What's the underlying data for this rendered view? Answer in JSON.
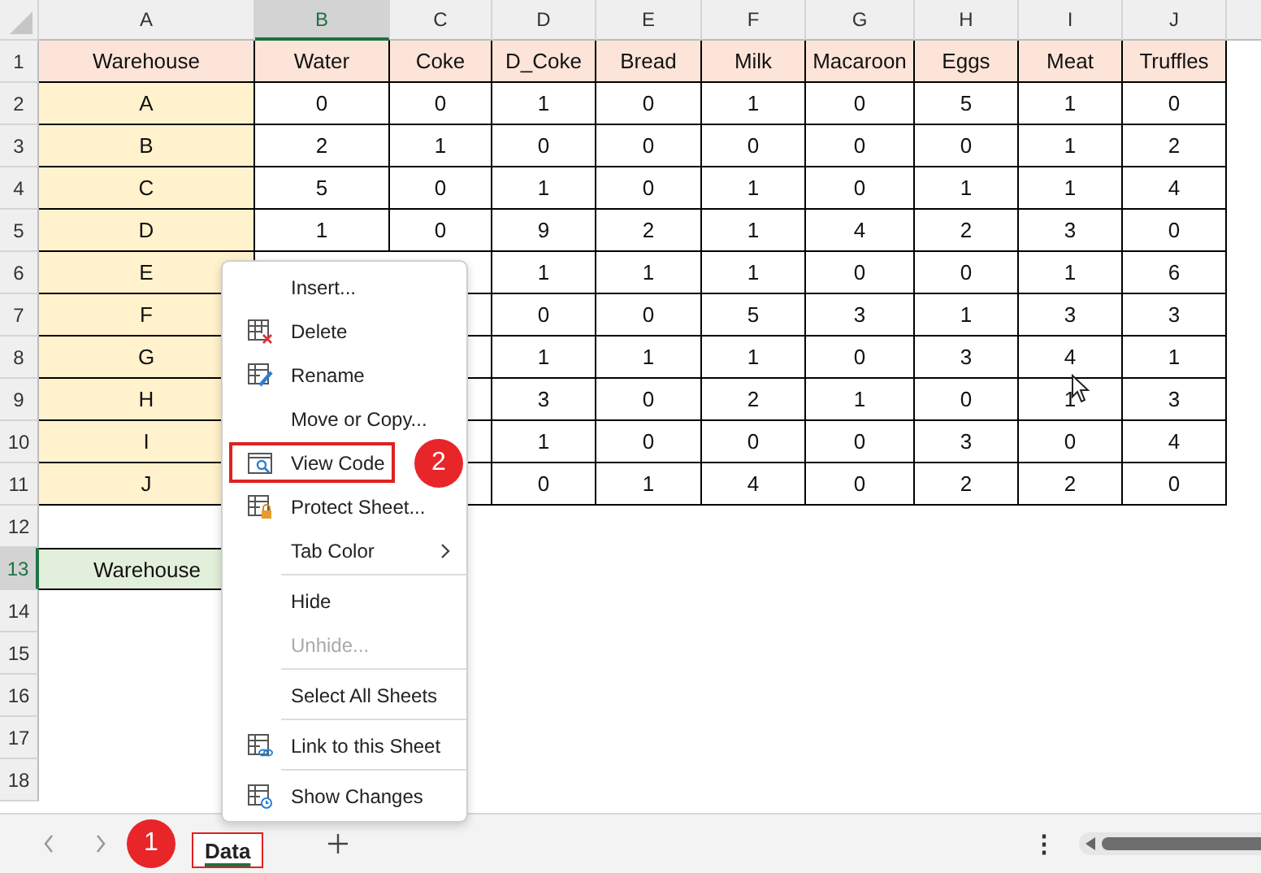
{
  "columns": [
    {
      "label": "A",
      "selected": false
    },
    {
      "label": "B",
      "selected": true
    },
    {
      "label": "C",
      "selected": false
    },
    {
      "label": "D",
      "selected": false
    },
    {
      "label": "E",
      "selected": false
    },
    {
      "label": "F",
      "selected": false
    },
    {
      "label": "G",
      "selected": false
    },
    {
      "label": "H",
      "selected": false
    },
    {
      "label": "I",
      "selected": false
    },
    {
      "label": "J",
      "selected": false
    }
  ],
  "rows": [
    {
      "number": "1",
      "selected": false,
      "kind": "header",
      "cells": [
        "Warehouse",
        "Water",
        "Coke",
        "D_Coke",
        "Bread",
        "Milk",
        "Macaroon",
        "Eggs",
        "Meat",
        "Truffles"
      ]
    },
    {
      "number": "2",
      "selected": false,
      "kind": "data",
      "cells": [
        "A",
        "0",
        "0",
        "1",
        "0",
        "1",
        "0",
        "5",
        "1",
        "0"
      ]
    },
    {
      "number": "3",
      "selected": false,
      "kind": "data",
      "cells": [
        "B",
        "2",
        "1",
        "0",
        "0",
        "0",
        "0",
        "0",
        "1",
        "2"
      ]
    },
    {
      "number": "4",
      "selected": false,
      "kind": "data",
      "cells": [
        "C",
        "5",
        "0",
        "1",
        "0",
        "1",
        "0",
        "1",
        "1",
        "4"
      ]
    },
    {
      "number": "5",
      "selected": false,
      "kind": "data",
      "cells": [
        "D",
        "1",
        "0",
        "9",
        "2",
        "1",
        "4",
        "2",
        "3",
        "0"
      ]
    },
    {
      "number": "6",
      "selected": false,
      "kind": "data",
      "cells": [
        "E",
        null,
        null,
        "1",
        "1",
        "1",
        "0",
        "0",
        "1",
        "6"
      ]
    },
    {
      "number": "7",
      "selected": false,
      "kind": "data",
      "cells": [
        "F",
        null,
        null,
        "0",
        "0",
        "5",
        "3",
        "1",
        "3",
        "3"
      ]
    },
    {
      "number": "8",
      "selected": false,
      "kind": "data",
      "cells": [
        "G",
        null,
        null,
        "1",
        "1",
        "1",
        "0",
        "3",
        "4",
        "1"
      ]
    },
    {
      "number": "9",
      "selected": false,
      "kind": "data",
      "cells": [
        "H",
        null,
        null,
        "3",
        "0",
        "2",
        "1",
        "0",
        "1",
        "3"
      ]
    },
    {
      "number": "10",
      "selected": false,
      "kind": "data",
      "cells": [
        "I",
        null,
        null,
        "1",
        "0",
        "0",
        "0",
        "3",
        "0",
        "4"
      ]
    },
    {
      "number": "11",
      "selected": false,
      "kind": "data",
      "cells": [
        "J",
        null,
        null,
        "0",
        "1",
        "4",
        "0",
        "2",
        "2",
        "0"
      ]
    },
    {
      "number": "12",
      "selected": false,
      "kind": "empty",
      "cells": []
    },
    {
      "number": "13",
      "selected": true,
      "kind": "criteria",
      "cells": [
        "Warehouse"
      ]
    },
    {
      "number": "14",
      "selected": false,
      "kind": "empty",
      "cells": []
    },
    {
      "number": "15",
      "selected": false,
      "kind": "empty",
      "cells": []
    },
    {
      "number": "16",
      "selected": false,
      "kind": "empty",
      "cells": []
    },
    {
      "number": "17",
      "selected": false,
      "kind": "empty",
      "cells": []
    },
    {
      "number": "18",
      "selected": false,
      "kind": "empty",
      "cells": []
    }
  ],
  "context_menu": [
    {
      "kind": "item",
      "label": "Insert...",
      "disabled": false,
      "submenu": false
    },
    {
      "kind": "item",
      "label": "Delete",
      "disabled": false,
      "submenu": false
    },
    {
      "kind": "item",
      "label": "Rename",
      "disabled": false,
      "submenu": false
    },
    {
      "kind": "item",
      "label": "Move or Copy...",
      "disabled": false,
      "submenu": false
    },
    {
      "kind": "item",
      "label": "View Code",
      "disabled": false,
      "submenu": false,
      "callout": "2"
    },
    {
      "kind": "item",
      "label": "Protect Sheet...",
      "disabled": false,
      "submenu": false
    },
    {
      "kind": "item",
      "label": "Tab Color",
      "disabled": false,
      "submenu": true
    },
    {
      "kind": "separator"
    },
    {
      "kind": "item",
      "label": "Hide",
      "disabled": false,
      "submenu": false
    },
    {
      "kind": "item",
      "label": "Unhide...",
      "disabled": true,
      "submenu": false
    },
    {
      "kind": "separator"
    },
    {
      "kind": "item",
      "label": "Select All Sheets",
      "disabled": false,
      "submenu": false
    },
    {
      "kind": "separator"
    },
    {
      "kind": "item",
      "label": "Link to this Sheet",
      "disabled": false,
      "submenu": false
    },
    {
      "kind": "separator"
    },
    {
      "kind": "item",
      "label": "Show Changes",
      "disabled": false,
      "submenu": false
    }
  ],
  "sheet_tabs": [
    {
      "label": "Data",
      "selected": true,
      "callout": "1"
    }
  ],
  "tab_bar": {
    "more_options": "⋮"
  }
}
